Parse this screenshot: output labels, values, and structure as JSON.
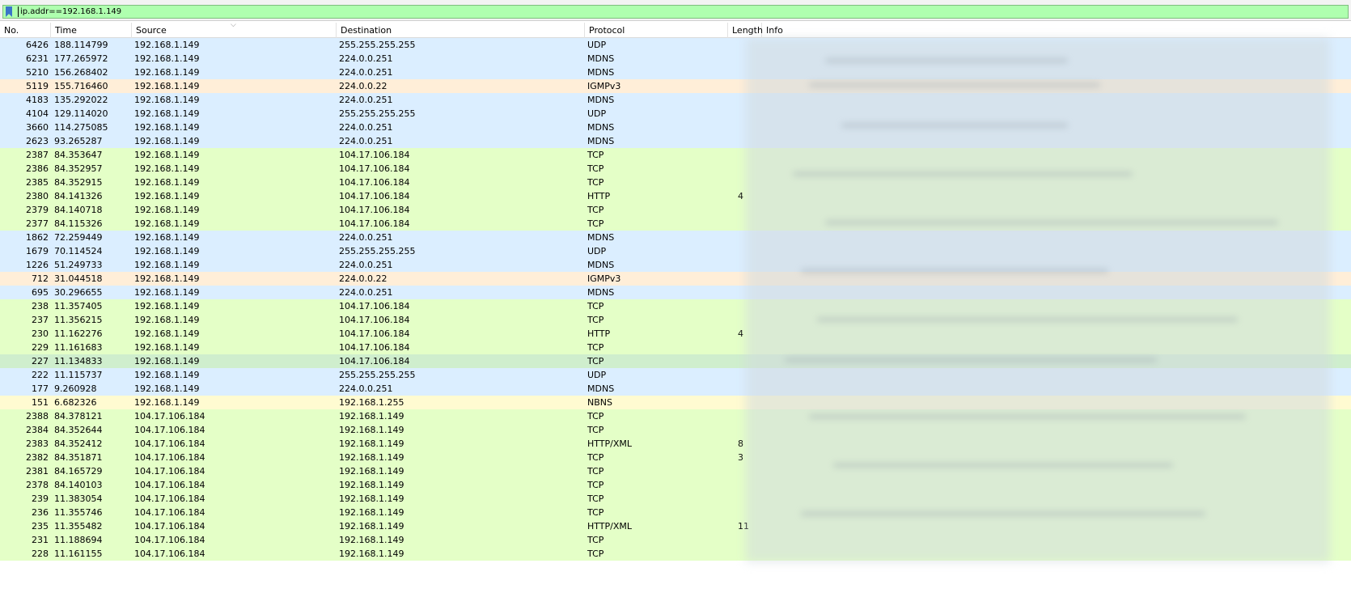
{
  "filter": {
    "value": "ip.addr==192.168.1.149"
  },
  "colors": {
    "udp": "#dbeeff",
    "tcp": "#e4ffc7",
    "igmp": "#ffeed8",
    "nbns": "#fffbd1",
    "selected_tcp": "#cfeecd"
  },
  "columns": [
    "No.",
    "Time",
    "Source",
    "Destination",
    "Protocol",
    "Length",
    "Info"
  ],
  "packets": [
    {
      "no": "6426",
      "time": "188.114799",
      "src": "192.168.1.149",
      "dst": "255.255.255.255",
      "proto": "UDP",
      "len": "",
      "cls": "udp"
    },
    {
      "no": "6231",
      "time": "177.265972",
      "src": "192.168.1.149",
      "dst": "224.0.0.251",
      "proto": "MDNS",
      "len": "",
      "cls": "udp"
    },
    {
      "no": "5210",
      "time": "156.268402",
      "src": "192.168.1.149",
      "dst": "224.0.0.251",
      "proto": "MDNS",
      "len": "",
      "cls": "udp"
    },
    {
      "no": "5119",
      "time": "155.716460",
      "src": "192.168.1.149",
      "dst": "224.0.0.22",
      "proto": "IGMPv3",
      "len": "",
      "cls": "igmp"
    },
    {
      "no": "4183",
      "time": "135.292022",
      "src": "192.168.1.149",
      "dst": "224.0.0.251",
      "proto": "MDNS",
      "len": "",
      "cls": "udp"
    },
    {
      "no": "4104",
      "time": "129.114020",
      "src": "192.168.1.149",
      "dst": "255.255.255.255",
      "proto": "UDP",
      "len": "",
      "cls": "udp"
    },
    {
      "no": "3660",
      "time": "114.275085",
      "src": "192.168.1.149",
      "dst": "224.0.0.251",
      "proto": "MDNS",
      "len": "",
      "cls": "udp"
    },
    {
      "no": "2623",
      "time": "93.265287",
      "src": "192.168.1.149",
      "dst": "224.0.0.251",
      "proto": "MDNS",
      "len": "",
      "cls": "udp"
    },
    {
      "no": "2387",
      "time": "84.353647",
      "src": "192.168.1.149",
      "dst": "104.17.106.184",
      "proto": "TCP",
      "len": "",
      "cls": "tcp"
    },
    {
      "no": "2386",
      "time": "84.352957",
      "src": "192.168.1.149",
      "dst": "104.17.106.184",
      "proto": "TCP",
      "len": "",
      "cls": "tcp"
    },
    {
      "no": "2385",
      "time": "84.352915",
      "src": "192.168.1.149",
      "dst": "104.17.106.184",
      "proto": "TCP",
      "len": "",
      "cls": "tcp"
    },
    {
      "no": "2380",
      "time": "84.141326",
      "src": "192.168.1.149",
      "dst": "104.17.106.184",
      "proto": "HTTP",
      "len": "4",
      "cls": "tcp"
    },
    {
      "no": "2379",
      "time": "84.140718",
      "src": "192.168.1.149",
      "dst": "104.17.106.184",
      "proto": "TCP",
      "len": "",
      "cls": "tcp"
    },
    {
      "no": "2377",
      "time": "84.115326",
      "src": "192.168.1.149",
      "dst": "104.17.106.184",
      "proto": "TCP",
      "len": "",
      "cls": "tcp"
    },
    {
      "no": "1862",
      "time": "72.259449",
      "src": "192.168.1.149",
      "dst": "224.0.0.251",
      "proto": "MDNS",
      "len": "",
      "cls": "udp"
    },
    {
      "no": "1679",
      "time": "70.114524",
      "src": "192.168.1.149",
      "dst": "255.255.255.255",
      "proto": "UDP",
      "len": "",
      "cls": "udp"
    },
    {
      "no": "1226",
      "time": "51.249733",
      "src": "192.168.1.149",
      "dst": "224.0.0.251",
      "proto": "MDNS",
      "len": "",
      "cls": "udp"
    },
    {
      "no": "712",
      "time": "31.044518",
      "src": "192.168.1.149",
      "dst": "224.0.0.22",
      "proto": "IGMPv3",
      "len": "",
      "cls": "igmp"
    },
    {
      "no": "695",
      "time": "30.296655",
      "src": "192.168.1.149",
      "dst": "224.0.0.251",
      "proto": "MDNS",
      "len": "",
      "cls": "udp"
    },
    {
      "no": "238",
      "time": "11.357405",
      "src": "192.168.1.149",
      "dst": "104.17.106.184",
      "proto": "TCP",
      "len": "",
      "cls": "tcp"
    },
    {
      "no": "237",
      "time": "11.356215",
      "src": "192.168.1.149",
      "dst": "104.17.106.184",
      "proto": "TCP",
      "len": "",
      "cls": "tcp"
    },
    {
      "no": "230",
      "time": "11.162276",
      "src": "192.168.1.149",
      "dst": "104.17.106.184",
      "proto": "HTTP",
      "len": "4",
      "cls": "tcp"
    },
    {
      "no": "229",
      "time": "11.161683",
      "src": "192.168.1.149",
      "dst": "104.17.106.184",
      "proto": "TCP",
      "len": "",
      "cls": "tcp"
    },
    {
      "no": "227",
      "time": "11.134833",
      "src": "192.168.1.149",
      "dst": "104.17.106.184",
      "proto": "TCP",
      "len": "",
      "cls": "selected_tcp"
    },
    {
      "no": "222",
      "time": "11.115737",
      "src": "192.168.1.149",
      "dst": "255.255.255.255",
      "proto": "UDP",
      "len": "",
      "cls": "udp"
    },
    {
      "no": "177",
      "time": "9.260928",
      "src": "192.168.1.149",
      "dst": "224.0.0.251",
      "proto": "MDNS",
      "len": "",
      "cls": "udp"
    },
    {
      "no": "151",
      "time": "6.682326",
      "src": "192.168.1.149",
      "dst": "192.168.1.255",
      "proto": "NBNS",
      "len": "",
      "cls": "nbns"
    },
    {
      "no": "2388",
      "time": "84.378121",
      "src": "104.17.106.184",
      "dst": "192.168.1.149",
      "proto": "TCP",
      "len": "",
      "cls": "tcp"
    },
    {
      "no": "2384",
      "time": "84.352644",
      "src": "104.17.106.184",
      "dst": "192.168.1.149",
      "proto": "TCP",
      "len": "",
      "cls": "tcp"
    },
    {
      "no": "2383",
      "time": "84.352412",
      "src": "104.17.106.184",
      "dst": "192.168.1.149",
      "proto": "HTTP/XML",
      "len": "8",
      "cls": "tcp"
    },
    {
      "no": "2382",
      "time": "84.351871",
      "src": "104.17.106.184",
      "dst": "192.168.1.149",
      "proto": "TCP",
      "len": "3",
      "cls": "tcp"
    },
    {
      "no": "2381",
      "time": "84.165729",
      "src": "104.17.106.184",
      "dst": "192.168.1.149",
      "proto": "TCP",
      "len": "",
      "cls": "tcp"
    },
    {
      "no": "2378",
      "time": "84.140103",
      "src": "104.17.106.184",
      "dst": "192.168.1.149",
      "proto": "TCP",
      "len": "",
      "cls": "tcp"
    },
    {
      "no": "239",
      "time": "11.383054",
      "src": "104.17.106.184",
      "dst": "192.168.1.149",
      "proto": "TCP",
      "len": "",
      "cls": "tcp"
    },
    {
      "no": "236",
      "time": "11.355746",
      "src": "104.17.106.184",
      "dst": "192.168.1.149",
      "proto": "TCP",
      "len": "",
      "cls": "tcp"
    },
    {
      "no": "235",
      "time": "11.355482",
      "src": "104.17.106.184",
      "dst": "192.168.1.149",
      "proto": "HTTP/XML",
      "len": "11",
      "cls": "tcp"
    },
    {
      "no": "231",
      "time": "11.188694",
      "src": "104.17.106.184",
      "dst": "192.168.1.149",
      "proto": "TCP",
      "len": "",
      "cls": "tcp"
    },
    {
      "no": "228",
      "time": "11.161155",
      "src": "104.17.106.184",
      "dst": "192.168.1.149",
      "proto": "TCP",
      "len": "",
      "cls": "tcp"
    }
  ]
}
